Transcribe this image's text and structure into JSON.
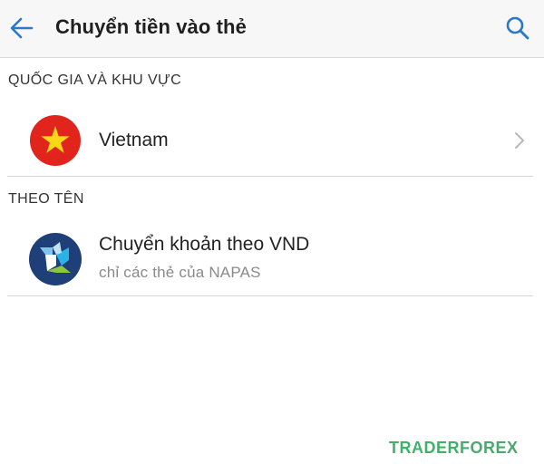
{
  "header": {
    "title": "Chuyển tiền vào thẻ",
    "back_icon": "arrow-left-icon",
    "search_icon": "search-icon",
    "accent_color": "#2b78c5"
  },
  "sections": [
    {
      "label": "QUỐC GIA VÀ KHU VỰC",
      "items": [
        {
          "icon": "vietnam-flag-icon",
          "title": "Vietnam",
          "trailing_icon": "chevron-right-icon"
        }
      ]
    },
    {
      "label": "THEO TÊN",
      "items": [
        {
          "icon": "napas-logo-icon",
          "title": "Chuyển khoản theo VND",
          "subtitle": "chỉ các thẻ của NAPAS"
        }
      ]
    }
  ],
  "watermark": {
    "part1": "TRADER",
    "part2": "FOREX"
  }
}
